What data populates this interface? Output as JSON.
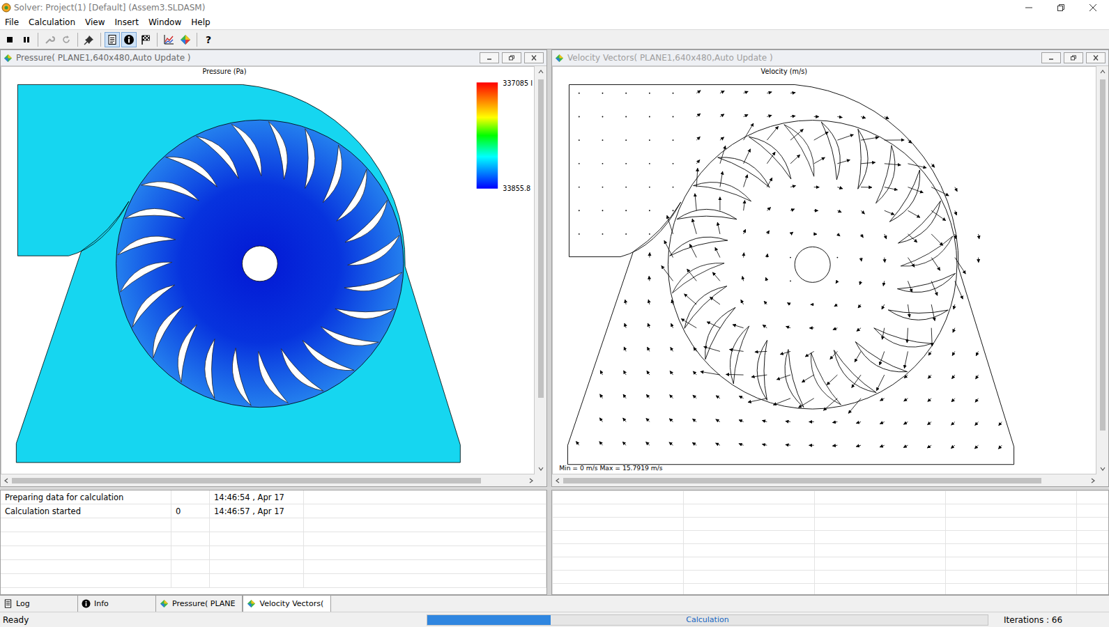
{
  "window": {
    "title": "Solver: Project(1) [Default] (Assem3.SLDASM)"
  },
  "menu": [
    "File",
    "Calculation",
    "View",
    "Insert",
    "Window",
    "Help"
  ],
  "toolbar": {
    "buttons": [
      {
        "pressed": false,
        "disabled": false
      },
      {
        "pressed": false,
        "disabled": false
      },
      {
        "pressed": false,
        "disabled": true
      },
      {
        "pressed": false,
        "disabled": true
      },
      {
        "pressed": false,
        "disabled": false
      },
      {
        "pressed": true,
        "disabled": false
      },
      {
        "pressed": true,
        "disabled": false
      },
      {
        "pressed": false,
        "disabled": false
      },
      {
        "pressed": false,
        "disabled": false
      },
      {
        "pressed": false,
        "disabled": false
      }
    ],
    "help": "?"
  },
  "panes": [
    {
      "title": "Pressure( PLANE1,640x480,Auto Update )",
      "active": true,
      "kind": "pressure",
      "plot_title": "Pressure (Pa)",
      "legend": {
        "max": "337085 I",
        "min": "33855.8"
      }
    },
    {
      "title": "Velocity Vectors( PLANE1,640x480,Auto Update )",
      "active": false,
      "kind": "vectors",
      "plot_title": "Velocity (m/s)",
      "footer": "Min = 0 m/s    Max = 15.7919 m/s"
    }
  ],
  "impeller": {
    "blades": 24
  },
  "log": {
    "rows": [
      {
        "event": "Preparing data for calculation",
        "iteration": "",
        "time": "14:46:54 , Apr 17"
      },
      {
        "event": "Calculation started",
        "iteration": "0",
        "time": "14:46:57 , Apr 17"
      }
    ]
  },
  "tabs": [
    {
      "label": "Log",
      "kind": "log",
      "selected": false
    },
    {
      "label": "Info",
      "kind": "info",
      "selected": false
    },
    {
      "label": "Pressure( PLANE",
      "kind": "plot",
      "selected": false
    },
    {
      "label": "Velocity Vectors(",
      "kind": "plot",
      "selected": true
    }
  ],
  "status_bar": {
    "text": "Ready",
    "progress": {
      "label": "Calculation",
      "level": 0.22
    },
    "iterations": "Iterations : 66"
  }
}
